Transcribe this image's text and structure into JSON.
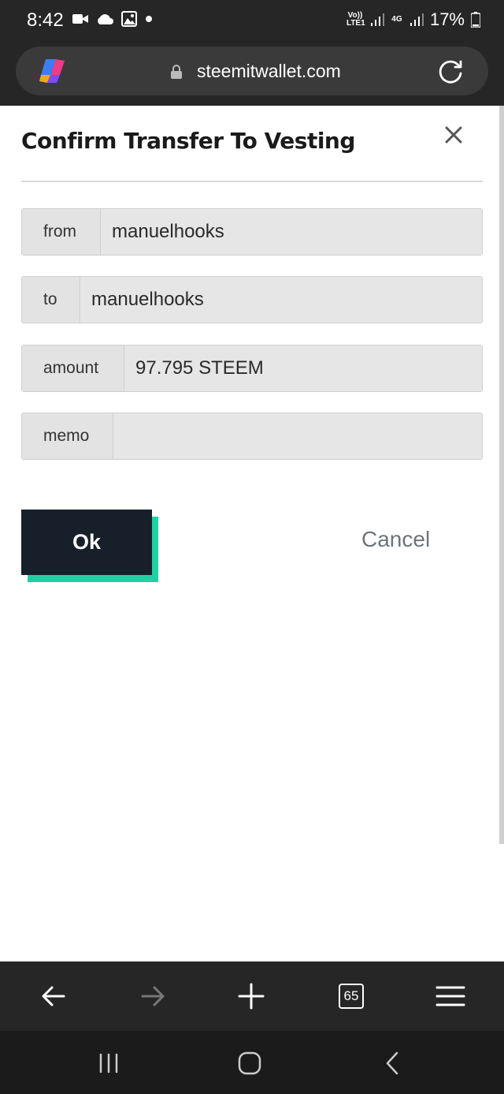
{
  "status_bar": {
    "time": "8:42",
    "network_1": "Vo)) LTE1",
    "network_2": "4G",
    "battery": "17%"
  },
  "browser": {
    "url": "steemitwallet.com",
    "tab_count": "65"
  },
  "modal": {
    "title": "Confirm Transfer To Vesting",
    "fields": [
      {
        "label": "from",
        "value": "manuelhooks"
      },
      {
        "label": "to",
        "value": "manuelhooks"
      },
      {
        "label": "amount",
        "value": "97.795 STEEM"
      },
      {
        "label": "memo",
        "value": ""
      }
    ],
    "ok_label": "Ok",
    "cancel_label": "Cancel"
  },
  "colors": {
    "ok_button": "#17202a",
    "ok_shadow": "#1fd1a4",
    "status_bar": "#262626"
  },
  "icons": {
    "status_left": [
      "video-camera-icon",
      "cloud-icon",
      "image-icon",
      "dot-icon"
    ],
    "status_right": [
      "signal-icon",
      "signal-icon",
      "battery-icon"
    ],
    "browser_top": [
      "copilot-icon",
      "lock-icon",
      "reload-icon"
    ],
    "browser_bottom": [
      "back-arrow-icon",
      "forward-arrow-icon",
      "new-tab-plus-icon",
      "tabs-counter-icon",
      "menu-icon"
    ],
    "nav_bar": [
      "recent-apps-icon",
      "home-icon",
      "back-icon"
    ]
  }
}
